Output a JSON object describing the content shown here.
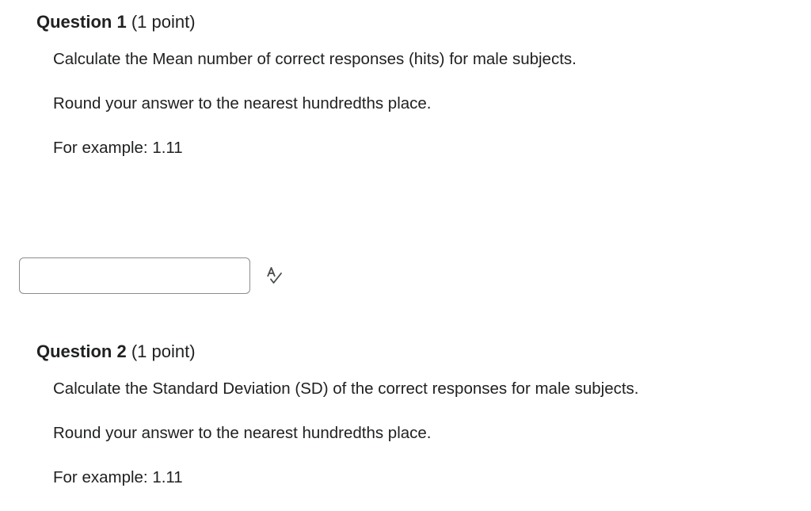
{
  "questions": [
    {
      "title": "Question 1",
      "points": "(1 point)",
      "lines": [
        "Calculate the Mean number of correct responses (hits) for male subjects.",
        "Round your answer to the nearest hundredths place.",
        "For example: 1.11"
      ],
      "answer": {
        "value": "",
        "icon": "spellcheck-icon"
      }
    },
    {
      "title": "Question 2",
      "points": "(1 point)",
      "lines": [
        "Calculate the Standard Deviation (SD) of the correct responses for male subjects.",
        "Round your answer to the nearest hundredths place.",
        "For example: 1.11"
      ]
    }
  ]
}
